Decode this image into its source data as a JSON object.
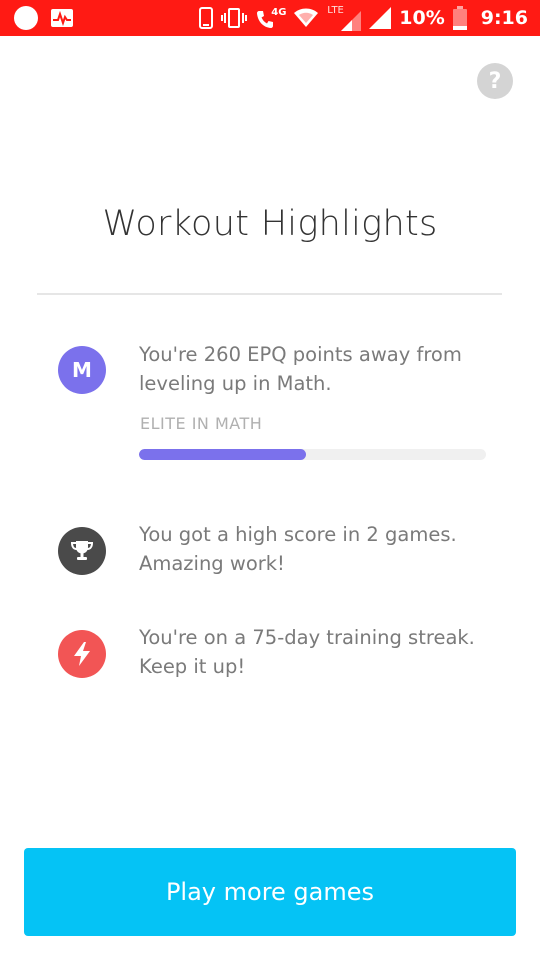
{
  "status_bar": {
    "network_type": "4G",
    "signal_label": "LTE",
    "battery": "10%",
    "time": "9:16"
  },
  "help": {
    "label": "?"
  },
  "title": "Workout Highlights",
  "highlights": [
    {
      "icon": "M",
      "icon_name": "math-badge-icon",
      "text": "You're 260 EPQ points away from leveling up in Math.",
      "level_label": "ELITE IN MATH",
      "progress": 0.48
    },
    {
      "icon_name": "trophy-icon",
      "text": "You got a high score in 2 games. Amazing work!"
    },
    {
      "icon_name": "lightning-icon",
      "text": "You're on a 75-day training streak. Keep it up!"
    }
  ],
  "cta": {
    "label": "Play more games"
  },
  "colors": {
    "status_bar": "#ff1a14",
    "math_accent": "#7b71ec",
    "trophy_bg": "#4a4a4a",
    "streak_bg": "#f25555",
    "cta_bg": "#05c3f5"
  }
}
